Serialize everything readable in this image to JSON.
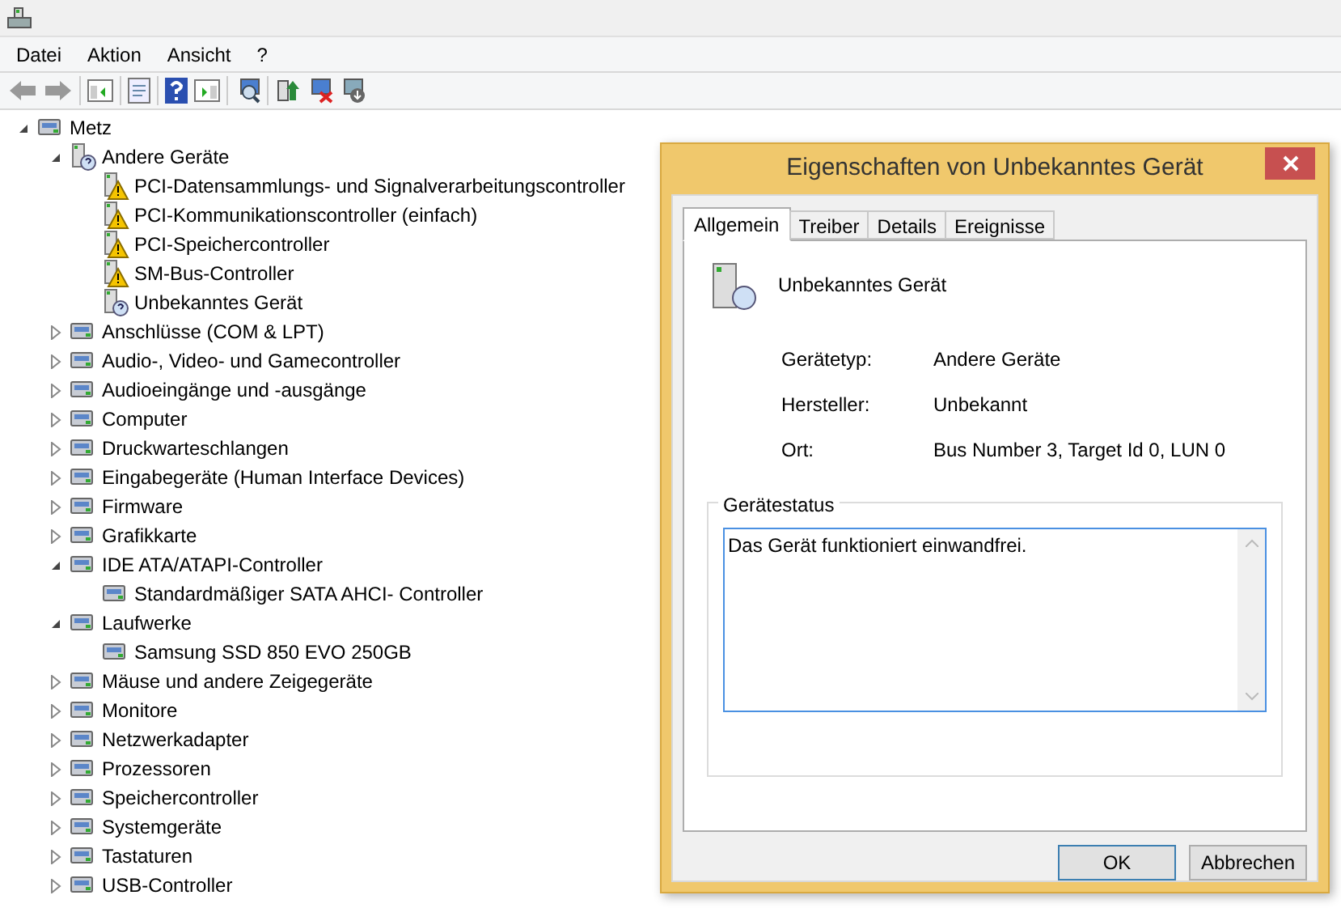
{
  "menu": [
    "Datei",
    "Aktion",
    "Ansicht",
    "?"
  ],
  "tree": [
    {
      "label": "Metz",
      "expanded": true,
      "children": [
        {
          "label": "Andere Geräte",
          "expanded": true,
          "unknown": true,
          "children": [
            {
              "label": "PCI-Datensammlungs- und Signalverarbeitungscontroller",
              "warning": true
            },
            {
              "label": "PCI-Kommunikationscontroller (einfach)",
              "warning": true
            },
            {
              "label": "PCI-Speichercontroller",
              "warning": true
            },
            {
              "label": "SM-Bus-Controller",
              "warning": true
            },
            {
              "label": "Unbekanntes Gerät",
              "warning": false,
              "unknown": true
            }
          ]
        },
        {
          "label": "Anschlüsse (COM & LPT)",
          "expanded": false
        },
        {
          "label": "Audio-, Video- und Gamecontroller",
          "expanded": false
        },
        {
          "label": "Audioeingänge und -ausgänge",
          "expanded": false
        },
        {
          "label": "Computer",
          "expanded": false
        },
        {
          "label": "Druckwarteschlangen",
          "expanded": false
        },
        {
          "label": "Eingabegeräte (Human Interface Devices)",
          "expanded": false
        },
        {
          "label": "Firmware",
          "expanded": false
        },
        {
          "label": "Grafikkarte",
          "expanded": false
        },
        {
          "label": "IDE ATA/ATAPI-Controller",
          "expanded": true,
          "children": [
            {
              "label": "Standardmäßiger SATA AHCI- Controller"
            }
          ]
        },
        {
          "label": "Laufwerke",
          "expanded": true,
          "children": [
            {
              "label": "Samsung SSD 850 EVO 250GB"
            }
          ]
        },
        {
          "label": "Mäuse und andere Zeigegeräte",
          "expanded": false
        },
        {
          "label": "Monitore",
          "expanded": false
        },
        {
          "label": "Netzwerkadapter",
          "expanded": false
        },
        {
          "label": "Prozessoren",
          "expanded": false
        },
        {
          "label": "Speichercontroller",
          "expanded": false
        },
        {
          "label": "Systemgeräte",
          "expanded": false
        },
        {
          "label": "Tastaturen",
          "expanded": false
        },
        {
          "label": "USB-Controller",
          "expanded": false
        }
      ]
    }
  ],
  "dialog": {
    "title": "Eigenschaften von Unbekanntes Gerät",
    "tabs": [
      {
        "label": "Allgemein",
        "selected": true
      },
      {
        "label": "Treiber",
        "selected": false
      },
      {
        "label": "Details",
        "selected": false
      },
      {
        "label": "Ereignisse",
        "selected": false
      }
    ],
    "device_name": "Unbekanntes Gerät",
    "properties": [
      {
        "label": "Gerätetyp:",
        "value": "Andere Geräte"
      },
      {
        "label": "Hersteller:",
        "value": "Unbekannt"
      },
      {
        "label": "Ort:",
        "value": "Bus Number 3, Target Id 0, LUN 0"
      }
    ],
    "status_group": {
      "title": "Gerätestatus",
      "text": "Das Gerät funktioniert einwandfrei."
    },
    "buttons": [
      {
        "label": "OK",
        "default": true
      },
      {
        "label": "Abbrechen",
        "default": false
      }
    ]
  }
}
